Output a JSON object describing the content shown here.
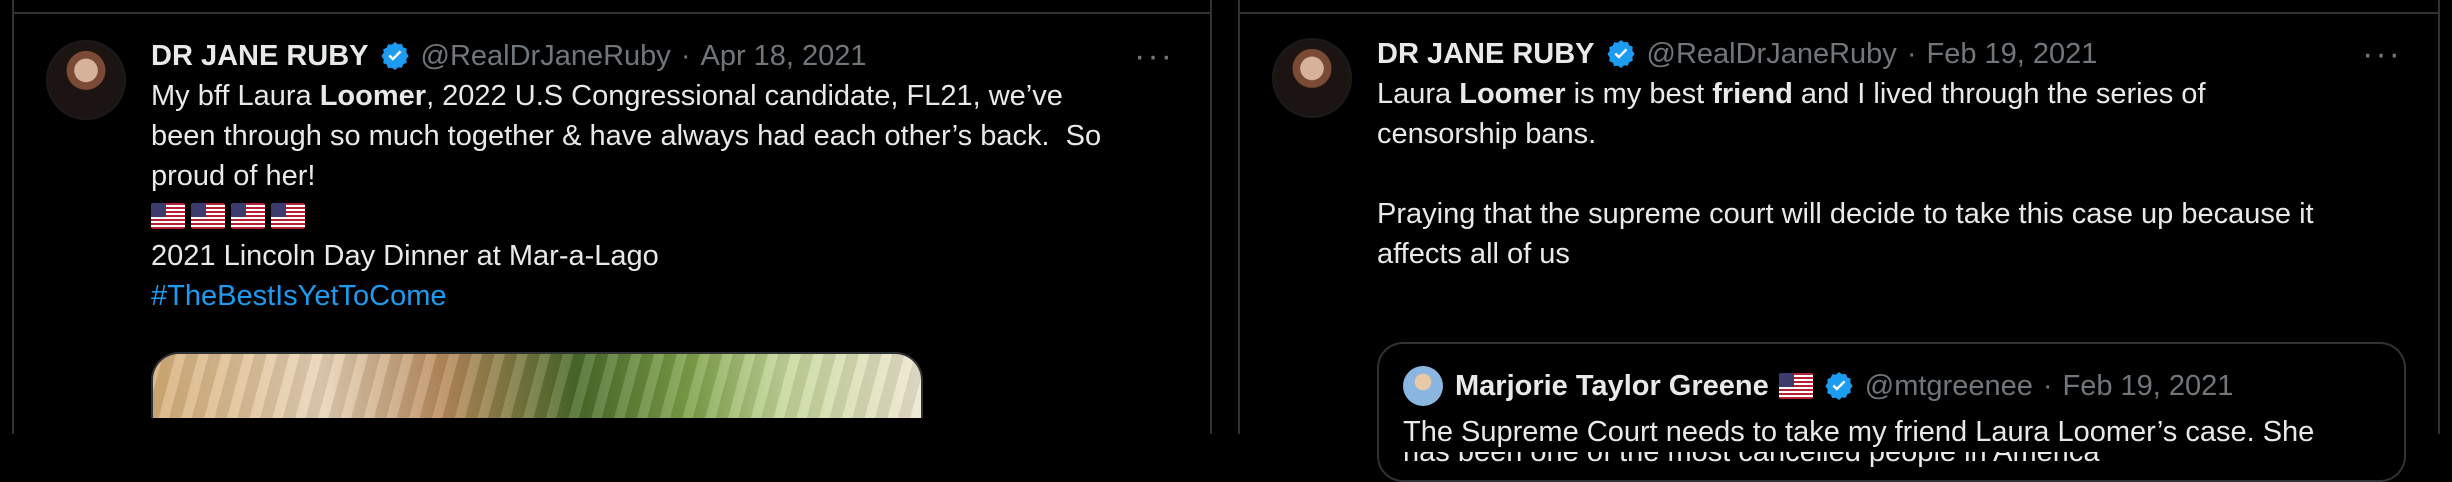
{
  "tweet1": {
    "name": "DR JANE RUBY",
    "handle": "@RealDrJaneRuby",
    "separator": "·",
    "date": "Apr 18, 2021",
    "more": "···",
    "line1_pre": "My bff Laura ",
    "line1_bold": "Loomer",
    "line1_post": ", 2022 U.S Congressional candidate, FL21, we’ve",
    "line2": "been through so much together & have always had each other’s back.  So",
    "line3": "proud of her!",
    "line4": "2021 Lincoln Day Dinner at Mar-a-Lago",
    "hashtag": "#TheBestIsYetToCome"
  },
  "tweet2": {
    "name": "DR JANE RUBY",
    "handle": "@RealDrJaneRuby",
    "separator": "·",
    "date": "Feb 19, 2021",
    "more": "···",
    "line1_pre": "Laura ",
    "line1_bold1": "Loomer",
    "line1_mid": " is my best ",
    "line1_bold2": "friend",
    "line1_post": " and I lived through the series of",
    "line2": "censorship bans.",
    "line3": "Praying that the supreme court will decide to take this case up because it",
    "line4": "affects all of us",
    "quote": {
      "name": "Marjorie Taylor Greene",
      "handle": "@mtgreenee",
      "separator": "·",
      "date": "Feb 19, 2021",
      "line1": "The Supreme Court needs to take my friend Laura Loomer’s case.  She",
      "line2": "has been one of the most cancelled people in America"
    }
  },
  "colors": {
    "background": "#000000",
    "text": "#e7e9ea",
    "muted": "#71767b",
    "link": "#1d9bf0",
    "verified": "#1d9bf0",
    "border": "#2f3336"
  },
  "icons": [
    "verified-badge-icon",
    "more-icon",
    "us-flag-icon"
  ]
}
